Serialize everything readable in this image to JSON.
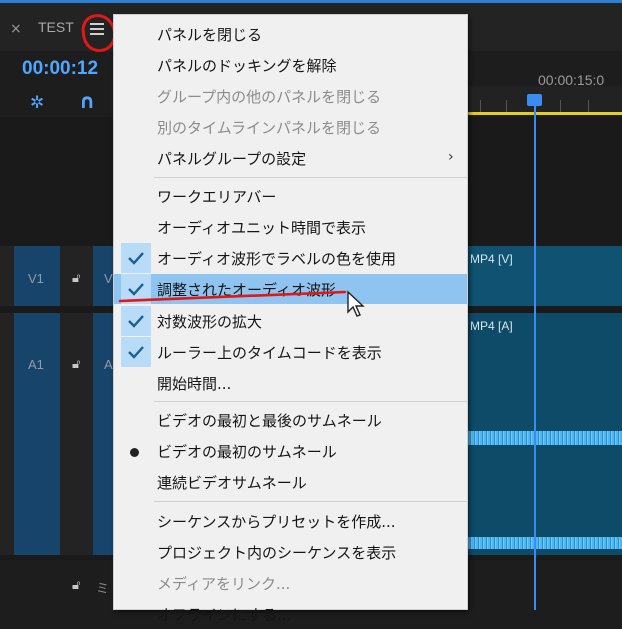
{
  "panel": {
    "close_glyph": "×",
    "title": "TEST",
    "timecode": "00:00:12",
    "ruler_time": "00:00:15:0",
    "accent_color": "#4fa7ff",
    "playhead_color": "#3b8cf0"
  },
  "tracks": {
    "v1": {
      "name": "V1",
      "clip_label": "MP4 [V]"
    },
    "a1": {
      "name": "A1",
      "clip_label": "MP4 [A]"
    },
    "v_short": "V",
    "a_short": "A",
    "bottom_label": "ミ"
  },
  "menu": {
    "items": [
      {
        "label": "パネルを閉じる",
        "enabled": true
      },
      {
        "label": "パネルのドッキングを解除",
        "enabled": true
      },
      {
        "label": "グループ内の他のパネルを閉じる",
        "enabled": false
      },
      {
        "label": "別のタイムラインパネルを閉じる",
        "enabled": false
      },
      {
        "label": "パネルグループの設定",
        "enabled": true,
        "submenu": true,
        "submenu_glyph": "›"
      },
      {
        "label": "ワークエリアバー",
        "enabled": true
      },
      {
        "label": "オーディオユニット時間で表示",
        "enabled": true
      },
      {
        "label": "オーディオ波形でラベルの色を使用",
        "enabled": true,
        "checked": true
      },
      {
        "label": "調整されたオーディオ波形",
        "enabled": true,
        "checked": true,
        "highlighted": true
      },
      {
        "label": "対数波形の拡大",
        "enabled": true,
        "checked": true
      },
      {
        "label": "ルーラー上のタイムコードを表示",
        "enabled": true,
        "checked": true
      },
      {
        "label": "開始時間...",
        "enabled": true
      },
      {
        "label": "ビデオの最初と最後のサムネール",
        "enabled": true
      },
      {
        "label": "ビデオの最初のサムネール",
        "enabled": true,
        "radio_selected": true
      },
      {
        "label": "連続ビデオサムネール",
        "enabled": true
      },
      {
        "label": "シーケンスからプリセットを作成...",
        "enabled": true
      },
      {
        "label": "プロジェクト内のシーケンスを表示",
        "enabled": true
      },
      {
        "label": "メディアをリンク...",
        "enabled": false
      },
      {
        "label": "オフラインにする...",
        "enabled": true
      }
    ],
    "highlight_color": "#8ec4ef",
    "check_bg_color": "#b8dbf8"
  },
  "annotation_color": "#e01818"
}
